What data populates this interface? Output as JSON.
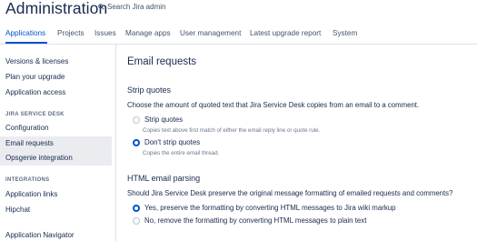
{
  "header": {
    "title": "Administration",
    "search_label": "Search Jira admin"
  },
  "tabs": [
    "Applications",
    "Projects",
    "Issues",
    "Manage apps",
    "User management",
    "Latest upgrade report",
    "System"
  ],
  "sidebar": {
    "items_top": [
      "Versions & licenses",
      "Plan your upgrade",
      "Application access"
    ],
    "section1": "JIRA SERVICE DESK",
    "items_jsd": [
      "Configuration",
      "Email requests",
      "Opsgenie integration"
    ],
    "section2": "INTEGRATIONS",
    "items_int": [
      "Application links",
      "Hipchat"
    ],
    "items_bottom": [
      "Application Navigator"
    ]
  },
  "main": {
    "title": "Email requests",
    "strip": {
      "heading": "Strip quotes",
      "description": "Choose the amount of quoted text that Jira Service Desk copies from an email to a comment.",
      "opt1_label": "Strip quotes",
      "opt1_hint": "Copies text above first match of either the email reply line or quote rule.",
      "opt2_label": "Don't strip quotes",
      "opt2_hint": "Copies the entire email thread."
    },
    "html": {
      "heading": "HTML email parsing",
      "description": "Should Jira Service Desk preserve the original message formatting of emailed requests and comments?",
      "opt1_label": "Yes, preserve the formatting by converting HTML messages to Jira wiki markup",
      "opt2_label": "No, remove the formatting by converting HTML messages to plain text"
    }
  }
}
